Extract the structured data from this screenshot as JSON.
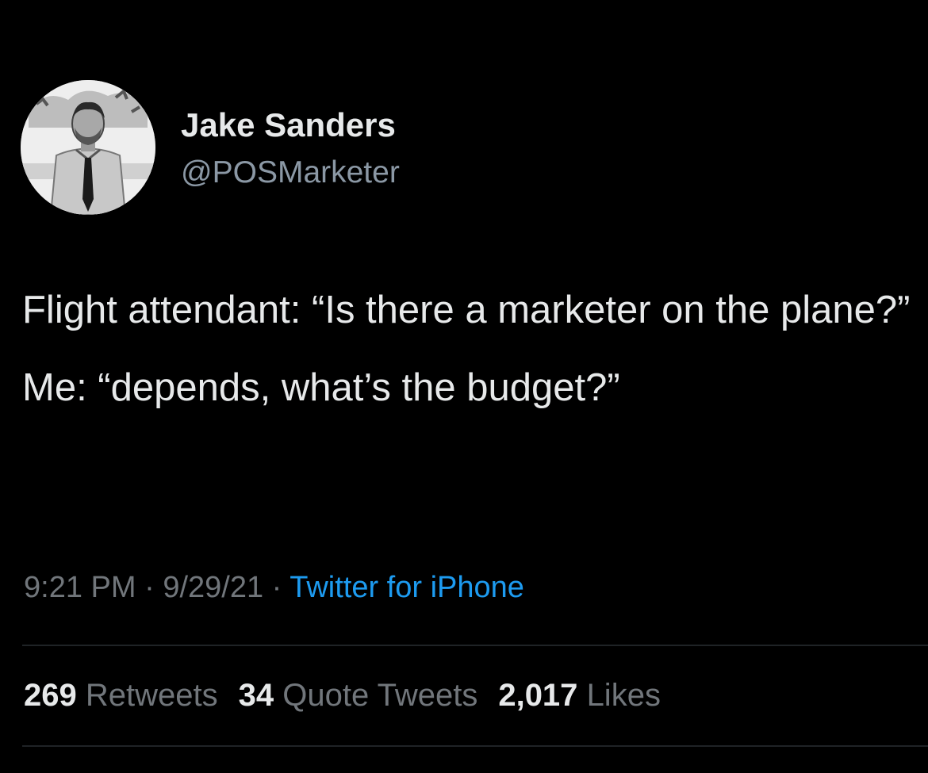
{
  "user": {
    "display_name": "Jake Sanders",
    "handle": "@POSMarketer",
    "avatar_icon": "profile-photo"
  },
  "tweet": {
    "lines": [
      "Flight attendant: “Is there a marketer on the plane?”",
      "Me: “depends, what’s the budget?”"
    ],
    "time": "9:21 PM",
    "separator": " · ",
    "date": "9/29/21",
    "source": "Twitter for iPhone"
  },
  "stats": {
    "retweets": {
      "count": "269",
      "label": "Retweets"
    },
    "quote_tweets": {
      "count": "34",
      "label": "Quote Tweets"
    },
    "likes": {
      "count": "2,017",
      "label": "Likes"
    }
  },
  "colors": {
    "background": "#000000",
    "primary_text": "#e7e9ea",
    "secondary_text": "#71767b",
    "link": "#1d9bf0"
  }
}
